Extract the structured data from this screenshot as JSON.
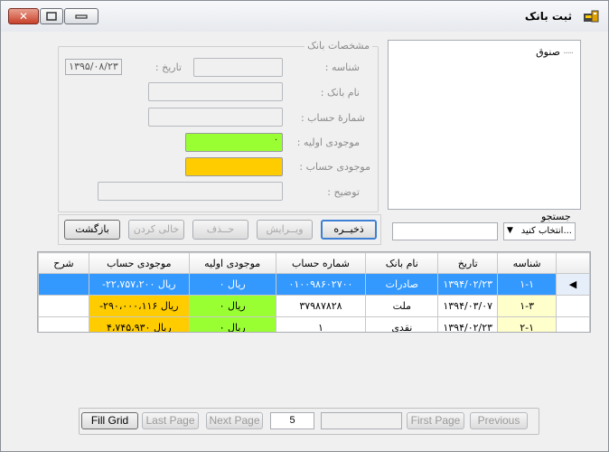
{
  "window": {
    "title": "ثبت بانک",
    "buttons": {
      "close": "✕",
      "maximize": "▢",
      "minimize": "—"
    }
  },
  "tree": {
    "items": [
      "صنوق"
    ]
  },
  "details": {
    "group_title": "مشخصات بانک",
    "id_label": "شناسه :",
    "date_label": "تاریخ :",
    "date_value": "۱۳۹۵/۰۸/۲۳",
    "bank_name_label": "نام بانک :",
    "account_number_label": "شمارهٔ حساب :",
    "initial_balance_label": "موجودی اولیه :",
    "initial_balance_value": "۰",
    "account_balance_label": "موجودی حساب :",
    "description_label": "توضیح :"
  },
  "actions": {
    "save": "ذخیــره",
    "edit": "ویــرایش",
    "delete": "حــذف",
    "clear": "خالی کردن",
    "back": "بازگشت"
  },
  "search": {
    "label": "جستجو",
    "select_value": "انتخاب کنید..."
  },
  "grid": {
    "columns": [
      "شناسه",
      "تاریخ",
      "نام بانک",
      "شماره حساب",
      "موجودی اولیه",
      "موجودی حساب",
      "شرح"
    ],
    "rows": [
      {
        "id": "۱-۱",
        "date": "۱۳۹۴/۰۲/۲۳",
        "bank": "صادرات",
        "account": "۰۱۰۰۹۸۶۰۲۷۰۰",
        "initial": "۰ ریال",
        "balance": "-۲۲،۷۵۷،۲۰۰ ریال",
        "desc": ""
      },
      {
        "id": "۱-۳",
        "date": "۱۳۹۴/۰۳/۰۷",
        "bank": "ملت",
        "account": "۳۷۹۸۷۸۲۸",
        "initial": "۰ ریال",
        "balance": "-۲۹۰،۰۰۰،۱۱۶ ریال",
        "desc": ""
      },
      {
        "id": "۲-۱",
        "date": "۱۳۹۴/۰۲/۲۳",
        "bank": "نقدی",
        "account": "۱",
        "initial": "۰ ریال",
        "balance": "۴،۷۴۵،۹۳۰ ریال",
        "desc": ""
      }
    ],
    "selected_row": 0
  },
  "pager": {
    "fill_grid": "Fill Grid",
    "last_page": "Last Page",
    "next_page": "Next Page",
    "page_size": "5",
    "page_info": "",
    "first_page": "First Page",
    "previous": "Previous"
  }
}
